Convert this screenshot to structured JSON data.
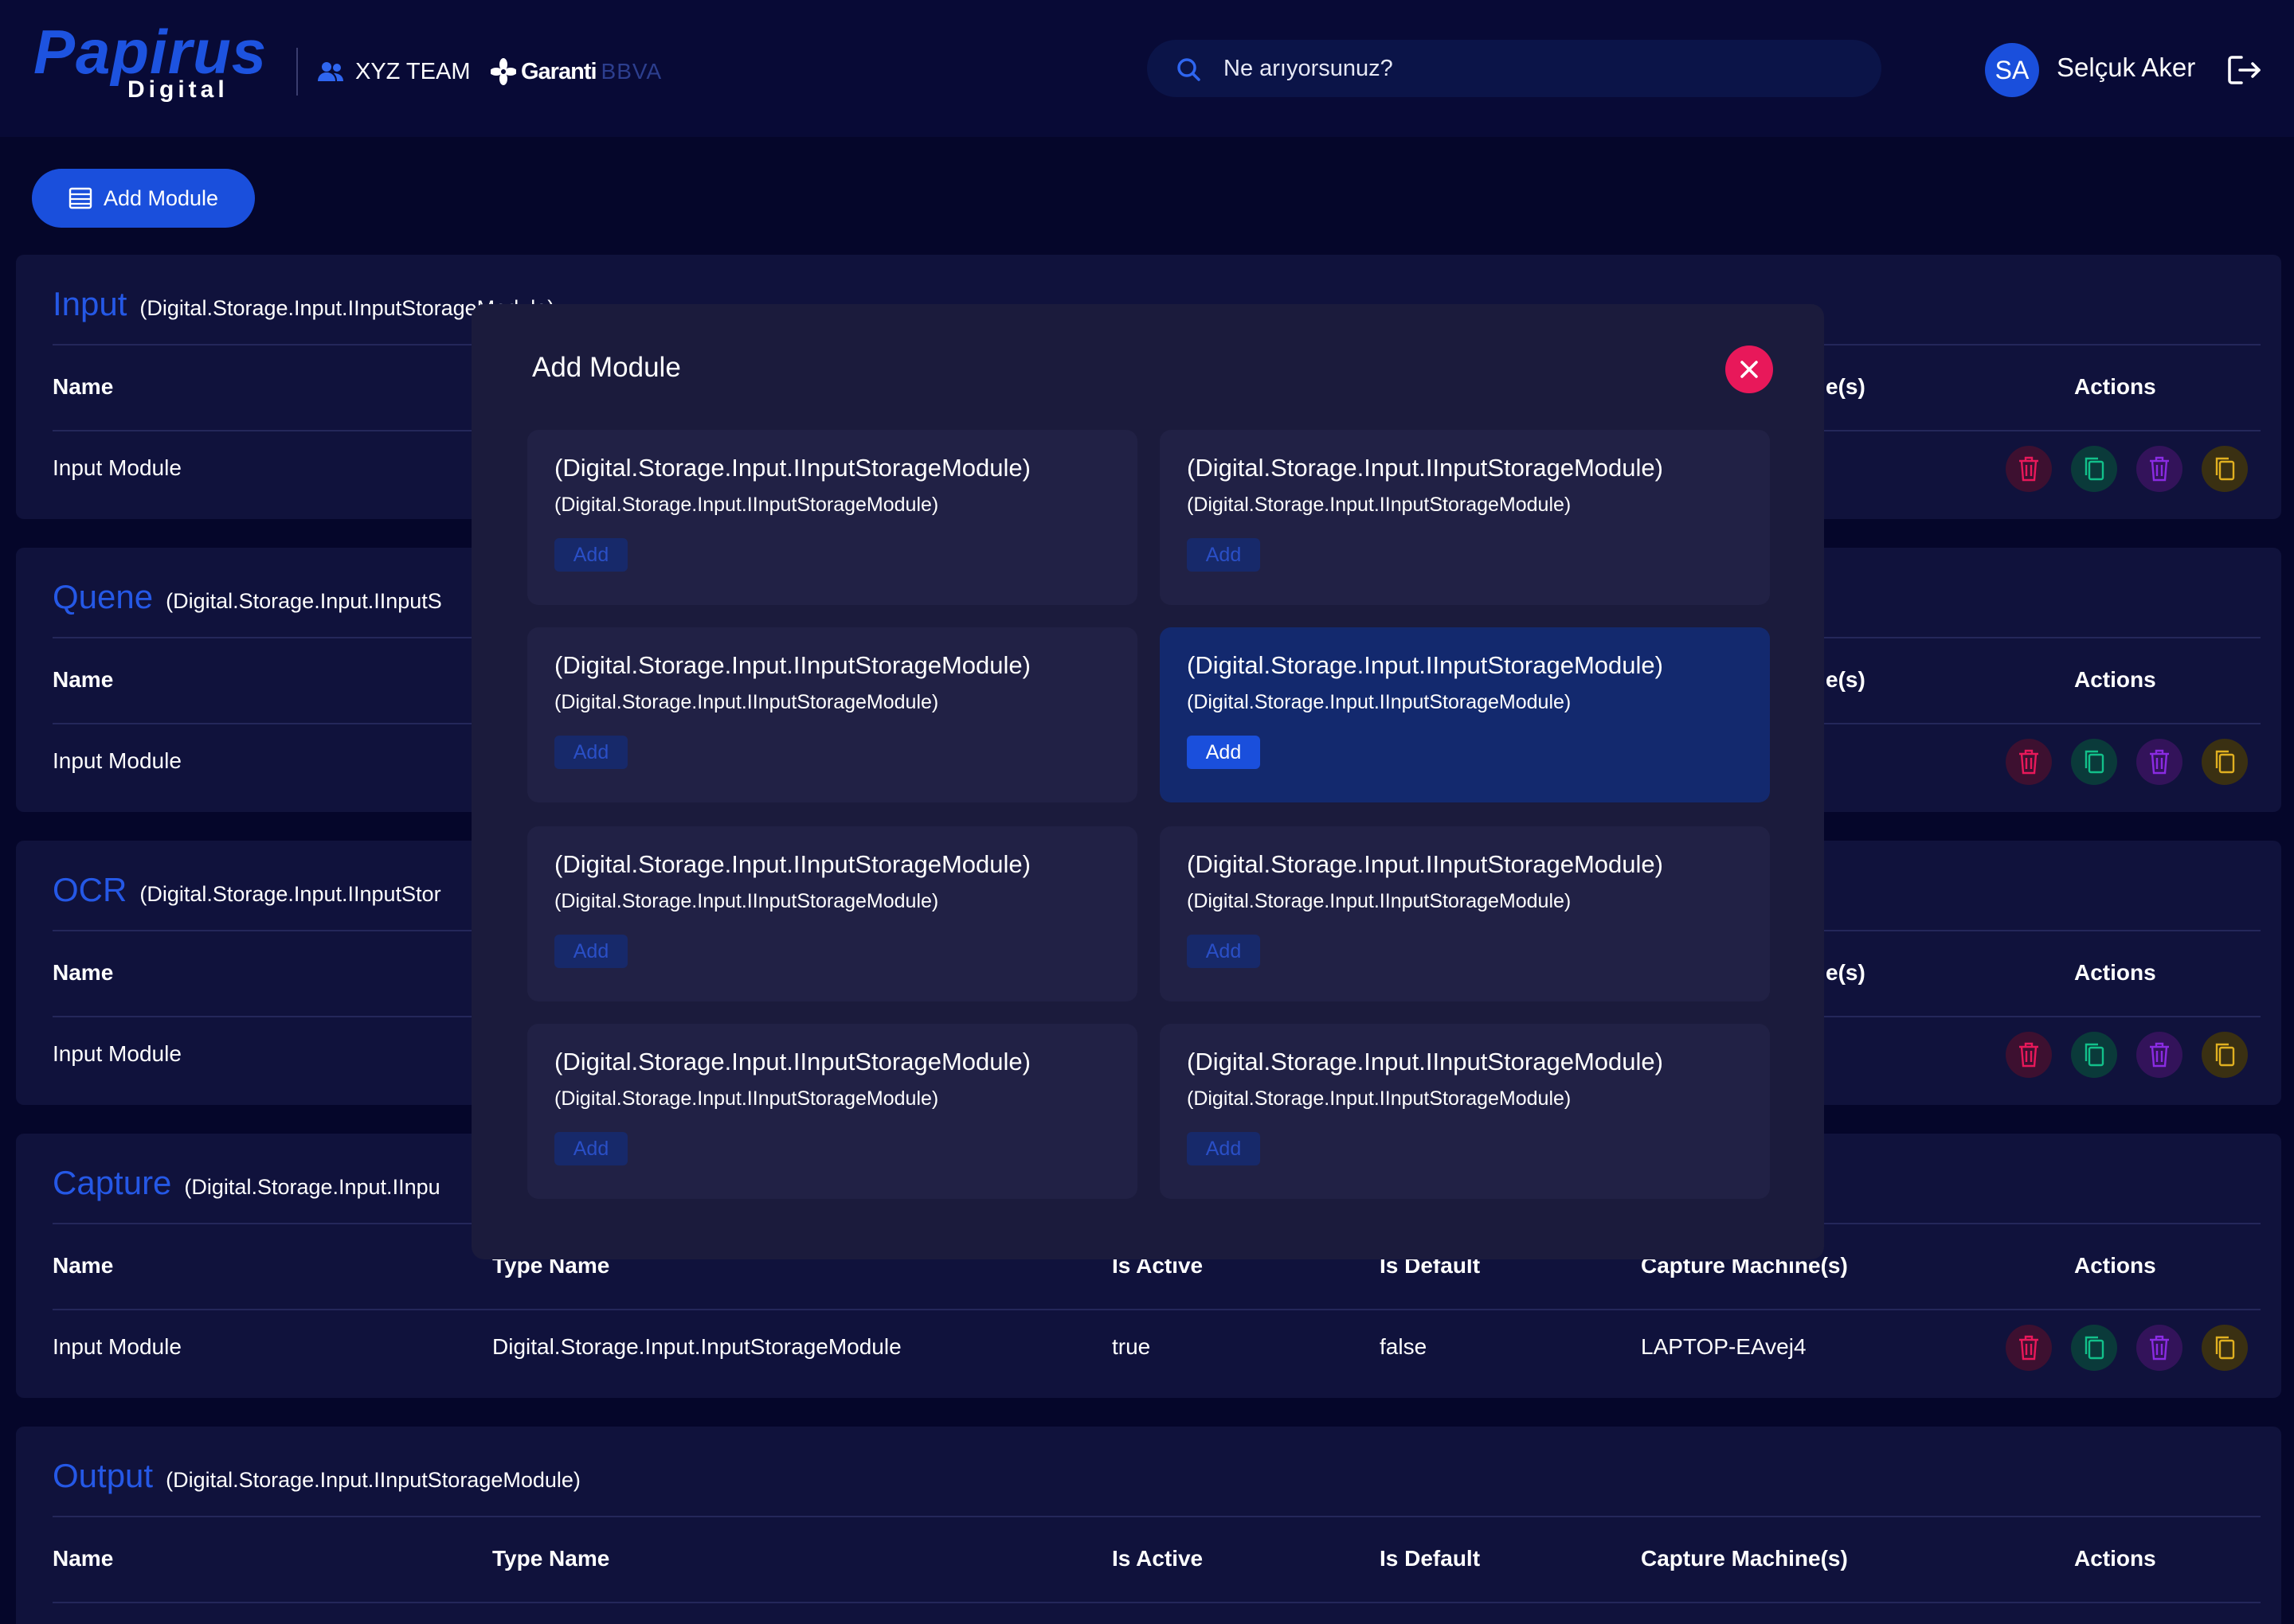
{
  "header": {
    "logo_main": "Papirus",
    "logo_sub": "Digital",
    "team": "XYZ TEAM",
    "bank_name": "Garanti",
    "bank_sub": "BBVA",
    "search_placeholder": "Ne arıyorsunuz?",
    "avatar_initials": "SA",
    "username": "Selçuk Aker"
  },
  "toolbar": {
    "add_module_label": "Add Module"
  },
  "columns": {
    "name": "Name",
    "type_name": "Type Name",
    "is_active": "Is Active",
    "is_default": "Is Default",
    "capture_machines": "Capture Machine(s)",
    "capture_machines_partial": "e(s)",
    "actions": "Actions"
  },
  "sections": [
    {
      "title": "Input",
      "type_visible": "(Digital.Storage.Input.IInputStorageModule)",
      "row_name": "Input Module"
    },
    {
      "title": "Quene",
      "type_visible": "(Digital.Storage.Input.IInputS",
      "row_name": "Input Module"
    },
    {
      "title": "OCR",
      "type_visible": "(Digital.Storage.Input.IInputStor",
      "row_name": "Input Module"
    },
    {
      "title": "Capture",
      "type_visible": "(Digital.Storage.Input.IInpu",
      "row": {
        "name": "Input Module",
        "type_name": "Digital.Storage.Input.InputStorageModule",
        "is_active": "true",
        "is_default": "false",
        "capture_machines": "LAPTOP-EAvej4"
      }
    },
    {
      "title": "Output",
      "type_visible": "(Digital.Storage.Input.IInputStorageModule)"
    }
  ],
  "modal": {
    "title": "Add Module",
    "cards": [
      {
        "title": "(Digital.Storage.Input.IInputStorageModule)",
        "subtitle": "(Digital.Storage.Input.IInputStorageModule)",
        "button": "Add",
        "selected": false
      },
      {
        "title": "(Digital.Storage.Input.IInputStorageModule)",
        "subtitle": "(Digital.Storage.Input.IInputStorageModule)",
        "button": "Add",
        "selected": false
      },
      {
        "title": "(Digital.Storage.Input.IInputStorageModule)",
        "subtitle": "(Digital.Storage.Input.IInputStorageModule)",
        "button": "Add",
        "selected": false
      },
      {
        "title": "(Digital.Storage.Input.IInputStorageModule)",
        "subtitle": "(Digital.Storage.Input.IInputStorageModule)",
        "button": "Add",
        "selected": true
      },
      {
        "title": "(Digital.Storage.Input.IInputStorageModule)",
        "subtitle": "(Digital.Storage.Input.IInputStorageModule)",
        "button": "Add",
        "selected": false
      },
      {
        "title": "(Digital.Storage.Input.IInputStorageModule)",
        "subtitle": "(Digital.Storage.Input.IInputStorageModule)",
        "button": "Add",
        "selected": false
      },
      {
        "title": "(Digital.Storage.Input.IInputStorageModule)",
        "subtitle": "(Digital.Storage.Input.IInputStorageModule)",
        "button": "Add",
        "selected": false
      },
      {
        "title": "(Digital.Storage.Input.IInputStorageModule)",
        "subtitle": "(Digital.Storage.Input.IInputStorageModule)",
        "button": "Add",
        "selected": false
      }
    ]
  },
  "icons": {
    "team": "users-icon",
    "bank": "garanti-clover-icon",
    "search": "search-icon",
    "logout": "logout-icon",
    "add_module": "list-icon",
    "delete": "trash-icon",
    "copy": "copy-icon",
    "close": "close-icon"
  },
  "colors": {
    "background": "#05062a",
    "header": "#080a36",
    "panel": "#10123c",
    "accent": "#1a4fdc",
    "section_title": "#2558e6",
    "modal": "#1b1b3c",
    "card": "#212145",
    "card_selected": "#13296e",
    "close": "#e8185a",
    "action_red": "#e8185a",
    "action_green": "#12c08a",
    "action_purple": "#8a2be2",
    "action_yellow": "#e0b020"
  }
}
